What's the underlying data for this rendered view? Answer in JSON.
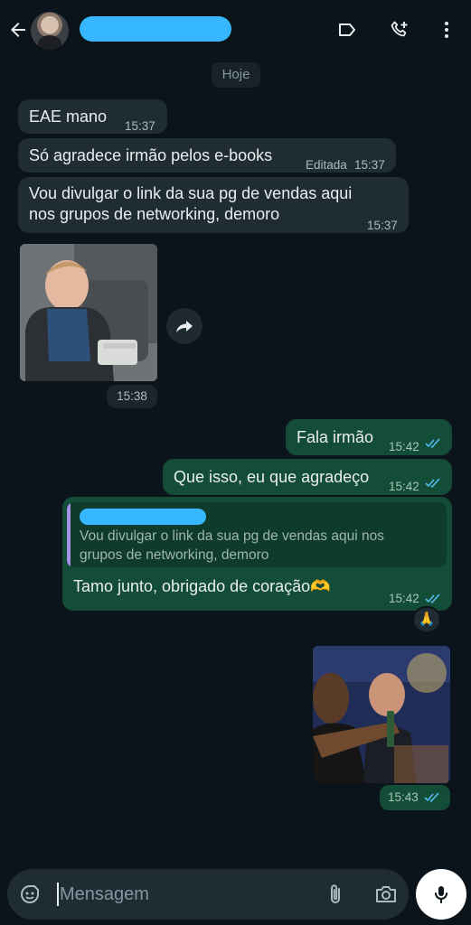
{
  "header": {
    "icons": [
      "back-arrow-icon",
      "label-icon",
      "add-call-icon",
      "more-vert-icon"
    ]
  },
  "date_chip": "Hoje",
  "messages": {
    "m1": {
      "text": "EAE mano",
      "time": "15:37"
    },
    "m2": {
      "text": "Só agradece irmão pelos e-books",
      "edited": "Editada",
      "time": "15:37"
    },
    "m3": {
      "text_line1": "Vou divulgar o link da sua pg de vendas aqui",
      "text_line2": "nos grupos de networking, demoro",
      "time": "15:37"
    },
    "m4_image": {
      "time": "15:38"
    },
    "m5": {
      "text": "Fala irmão",
      "time": "15:42"
    },
    "m6": {
      "text": "Que isso, eu que agradeço",
      "time": "15:42"
    },
    "m7": {
      "quote_line1": "Vou divulgar o link da sua pg de vendas aqui nos",
      "quote_line2": "grupos de networking, demoro",
      "text": "Tamo junto, obrigado de coração🫶",
      "time": "15:42",
      "reaction": "🙏"
    },
    "m8_image": {
      "time": "15:43"
    }
  },
  "composer": {
    "placeholder": "Mensagem",
    "icons": [
      "sticker-icon",
      "attach-icon",
      "camera-icon",
      "mic-icon"
    ]
  },
  "colors": {
    "background": "#0b141a",
    "incoming_bubble": "#202c33",
    "outgoing_bubble": "#144d37",
    "read_ticks": "#53bdeb",
    "redaction": "#37b7ff"
  }
}
